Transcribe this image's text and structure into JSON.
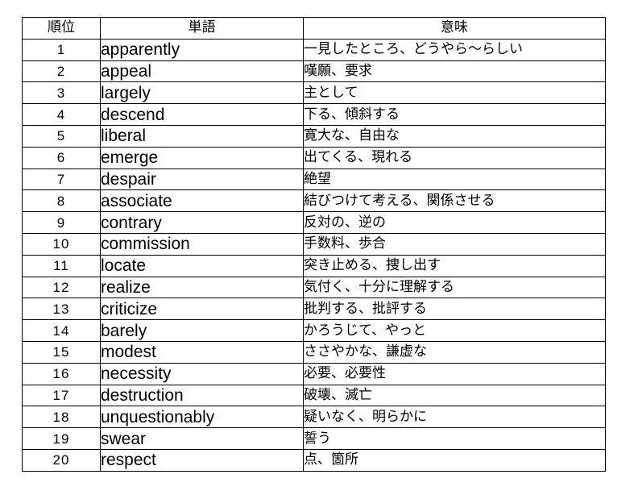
{
  "table": {
    "headers": {
      "rank": "順位",
      "word": "単語",
      "meaning": "意味"
    },
    "rows": [
      {
        "rank": "1",
        "word": "apparently",
        "meaning": "一見したところ、どうやら～らしい"
      },
      {
        "rank": "2",
        "word": "appeal",
        "meaning": "嘆願、要求"
      },
      {
        "rank": "3",
        "word": "largely",
        "meaning": "主として"
      },
      {
        "rank": "4",
        "word": "descend",
        "meaning": "下る、傾斜する"
      },
      {
        "rank": "5",
        "word": "liberal",
        "meaning": "寛大な、自由な"
      },
      {
        "rank": "6",
        "word": "emerge",
        "meaning": "出てくる、現れる"
      },
      {
        "rank": "7",
        "word": "despair",
        "meaning": "絶望"
      },
      {
        "rank": "8",
        "word": "associate",
        "meaning": "結びつけて考える、関係させる"
      },
      {
        "rank": "9",
        "word": "contrary",
        "meaning": "反対の、逆の"
      },
      {
        "rank": "10",
        "word": "commission",
        "meaning": "手数料、歩合"
      },
      {
        "rank": "11",
        "word": "locate",
        "meaning": "突き止める、捜し出す"
      },
      {
        "rank": "12",
        "word": "realize",
        "meaning": "気付く、十分に理解する"
      },
      {
        "rank": "13",
        "word": "criticize",
        "meaning": "批判する、批評する"
      },
      {
        "rank": "14",
        "word": "barely",
        "meaning": "かろうじて、やっと"
      },
      {
        "rank": "15",
        "word": "modest",
        "meaning": "ささやかな、謙虚な"
      },
      {
        "rank": "16",
        "word": "necessity",
        "meaning": "必要、必要性"
      },
      {
        "rank": "17",
        "word": "destruction",
        "meaning": "破壊、滅亡"
      },
      {
        "rank": "18",
        "word": "unquestionably",
        "meaning": "疑いなく、明らかに"
      },
      {
        "rank": "19",
        "word": "swear",
        "meaning": "誓う"
      },
      {
        "rank": "20",
        "word": "respect",
        "meaning": "点、箇所"
      }
    ]
  }
}
